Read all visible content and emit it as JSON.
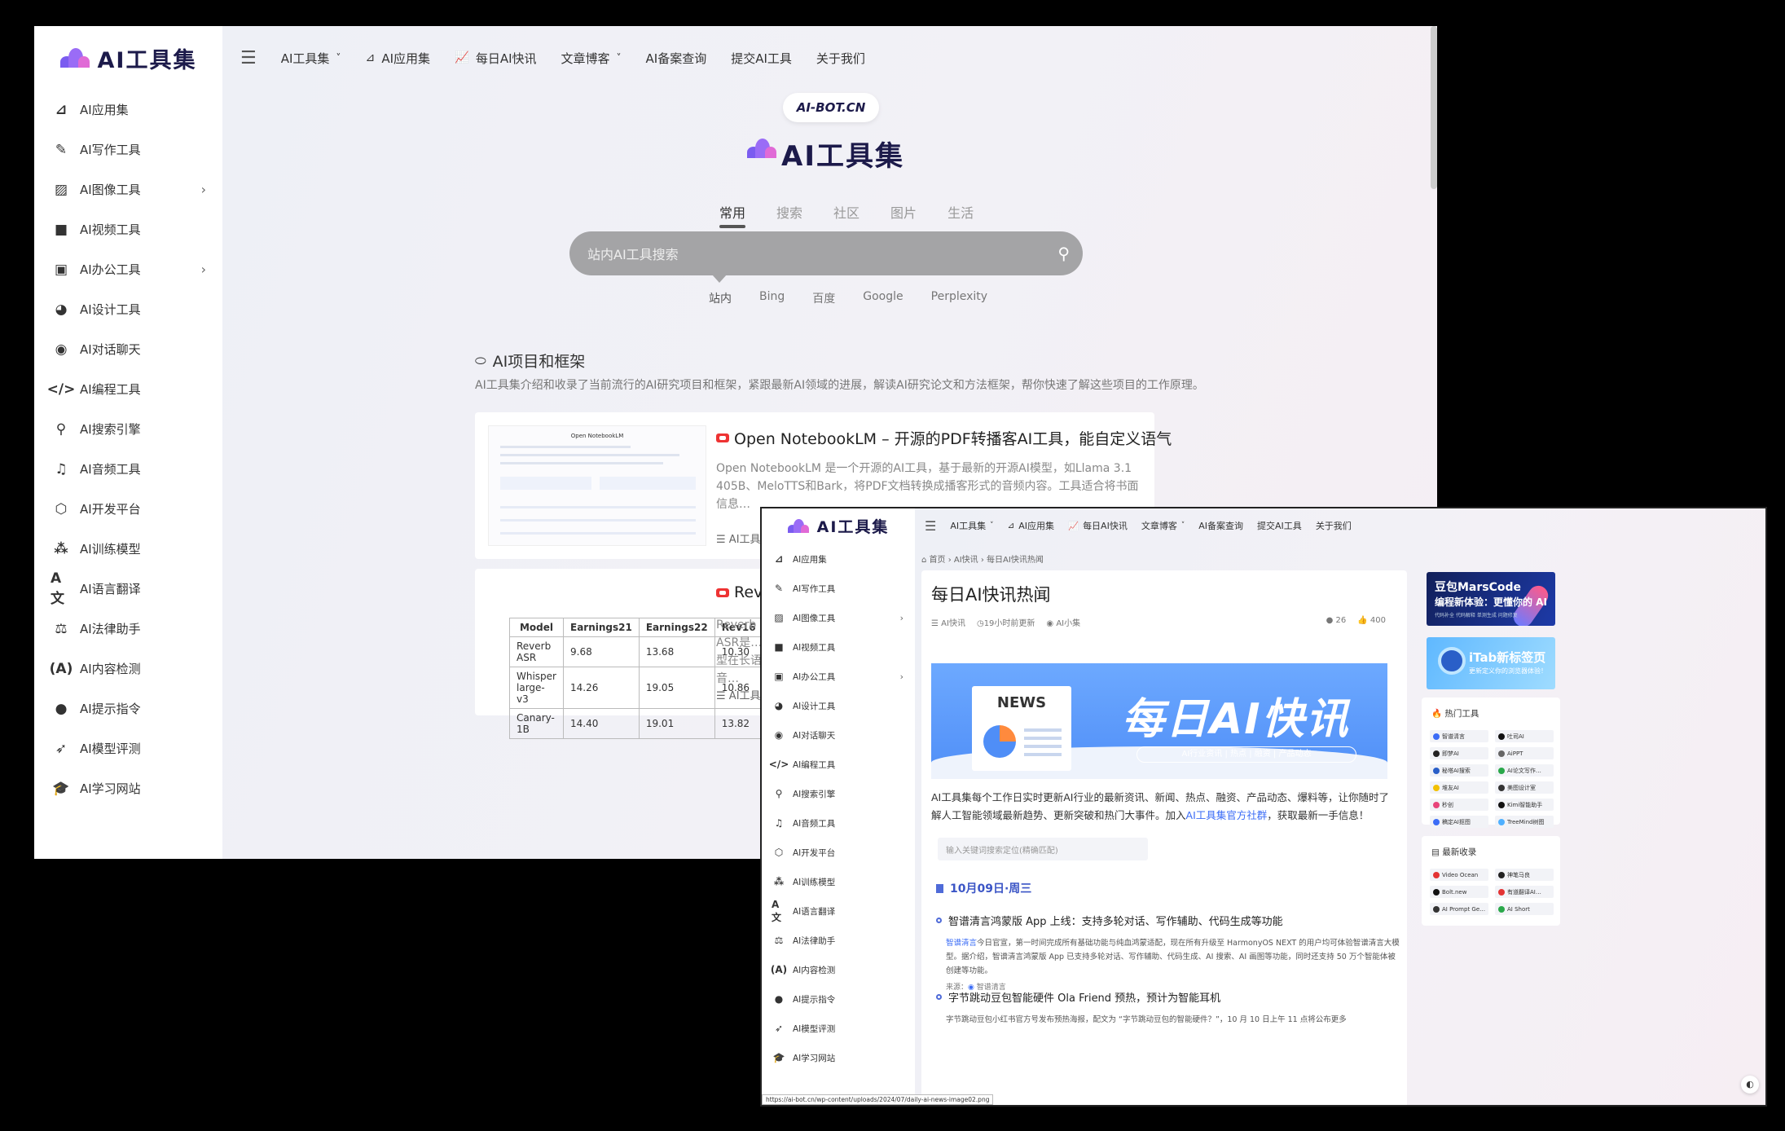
{
  "brand": {
    "name": "AI工具集",
    "site_badge": "AI-BOT.CN"
  },
  "sidebar": {
    "items": [
      {
        "label": "AI应用集",
        "icon": "app-store-icon",
        "glyph": "⊿"
      },
      {
        "label": "AI写作工具",
        "icon": "feather-icon",
        "glyph": "✎"
      },
      {
        "label": "AI图像工具",
        "icon": "image-icon",
        "glyph": "▨",
        "has_sub": true
      },
      {
        "label": "AI视频工具",
        "icon": "video-icon",
        "glyph": "■"
      },
      {
        "label": "AI办公工具",
        "icon": "briefcase-icon",
        "glyph": "▣",
        "has_sub": true
      },
      {
        "label": "AI设计工具",
        "icon": "palette-icon",
        "glyph": "◕"
      },
      {
        "label": "AI对话聊天",
        "icon": "chat-icon",
        "glyph": "◉"
      },
      {
        "label": "AI编程工具",
        "icon": "code-icon",
        "glyph": "</>"
      },
      {
        "label": "AI搜索引擎",
        "icon": "search-icon",
        "glyph": "⚲"
      },
      {
        "label": "AI音频工具",
        "icon": "music-icon",
        "glyph": "♫"
      },
      {
        "label": "AI开发平台",
        "icon": "cube-icon",
        "glyph": "⬡"
      },
      {
        "label": "AI训练模型",
        "icon": "cubes-icon",
        "glyph": "⁂"
      },
      {
        "label": "AI语言翻译",
        "icon": "translate-icon",
        "glyph": "A文"
      },
      {
        "label": "AI法律助手",
        "icon": "scales-icon",
        "glyph": "⚖"
      },
      {
        "label": "AI内容检测",
        "icon": "broadcast-icon",
        "glyph": "(A)"
      },
      {
        "label": "AI提示指令",
        "icon": "bulb-icon",
        "glyph": "●"
      },
      {
        "label": "AI模型评测",
        "icon": "rocket-icon",
        "glyph": "➶"
      },
      {
        "label": "AI学习网站",
        "icon": "graduation-icon",
        "glyph": "🎓"
      }
    ]
  },
  "topnav": [
    {
      "label": "AI工具集",
      "dropdown": true
    },
    {
      "label": "AI应用集",
      "icon": "app-store-icon"
    },
    {
      "label": "每日AI快讯",
      "icon": "chart-icon"
    },
    {
      "label": "文章博客",
      "dropdown": true
    },
    {
      "label": "AI备案查询"
    },
    {
      "label": "提交AI工具"
    },
    {
      "label": "关于我们"
    }
  ],
  "search": {
    "tabs": [
      "常用",
      "搜索",
      "社区",
      "图片",
      "生活"
    ],
    "placeholder": "站内AI工具搜索",
    "engines": [
      "站内",
      "Bing",
      "百度",
      "Google",
      "Perplexity"
    ]
  },
  "section": {
    "title": "AI项目和框架",
    "desc": "AI工具集介绍和收录了当前流行的AI研究项目和框架，紧跟最新AI领域的进展，解读AI研究论文和方法框架，帮你快速了解这些项目的工作原理。"
  },
  "cards": [
    {
      "title": "Open NotebookLM – 开源的PDF转播客AI工具，能自定义语气",
      "desc": "Open NotebookLM 是一个开源的AI工具，基于最新的开源AI模型，如Llama 3.1 405B、MeloTTS和Bark，将PDF文档转换成播客形式的音频内容。工具适合将书面信息…",
      "tag": "AI工具",
      "thumb_title": "Open NotebookLM"
    },
    {
      "title": "Reverb",
      "desc": "Reverb ASR是…模型在长语音…",
      "tag": "AI工具",
      "table": {
        "headers": [
          "Model",
          "Earnings21",
          "Earnings22",
          "Rev16"
        ],
        "rows": [
          [
            "Reverb ASR",
            "9.68",
            "13.68",
            "10.30"
          ],
          [
            "Whisper large-v3",
            "14.26",
            "19.05",
            "10.86"
          ],
          [
            "Canary-1B",
            "14.40",
            "19.01",
            "13.82"
          ]
        ]
      }
    }
  ],
  "article": {
    "breadcrumb": "⌂ 首页 › AI快讯 › 每日AI快讯热闻",
    "title": "每日AI快讯热闻",
    "category": "AI快讯",
    "updated": "19小时前更新",
    "author": "AI小集",
    "comments": "26",
    "likes": "400",
    "banner_title": "每日AI快讯",
    "banner_news": "NEWS",
    "banner_pill": "AI行业资讯 | 热点 | 融资 | 产品动态",
    "intro_a": "AI工具集每个工作日实时更新AI行业的最新资讯、新闻、热点、融资、产品动态、爆料等，让你随时了解人工智能领域最新趋势、更新突破和热门大事件。加入",
    "intro_link": "AI工具集官方社群",
    "intro_b": "，获取最新一手信息！",
    "kw_placeholder": "输入关键词搜索定位(精确匹配)",
    "date": "10月09日·周三",
    "news": [
      {
        "title": "智谱清言鸿蒙版 App 上线：支持多轮对话、写作辅助、代码生成等功能",
        "link": "智谱清言",
        "body": "今日官宣，第一时间完成所有基础功能与纯血鸿蒙适配，现在所有升级至 HarmonyOS NEXT 的用户均可体验智谱清言大模型。据介绍，智谱清言鸿蒙版 App 已支持多轮对话、写作辅助、代码生成、AI 搜索、AI 画图等功能，同时还支持 50 万个智能体被创建等功能。",
        "source_label": "来源：",
        "source": "智谱清言"
      },
      {
        "title": "字节跳动豆包智能硬件 Ola Friend 预热，预计为智能耳机",
        "body": "字节跳动豆包小红书官方号发布预热海报，配文为 “字节跳动豆包的智能硬件？”，10 月 10 日上午 11 点将公布更多"
      }
    ]
  },
  "ads": {
    "ad1_a": "豆包MarsCode",
    "ad1_b": "编程新体验：更懂你的 AI",
    "ad1_c": "代码补全  代码解释  单测生成  问题修复",
    "ad2_a": "iTab新标签页",
    "ad2_b": "更新定义你的浏览器体验！"
  },
  "hot_tools": {
    "title": "热门工具",
    "items": [
      {
        "name": "智谱清言",
        "color": "#3b6cf6"
      },
      {
        "name": "吐司AI",
        "color": "#111111"
      },
      {
        "name": "即梦AI",
        "color": "#222222"
      },
      {
        "name": "AiPPT",
        "color": "#666666"
      },
      {
        "name": "秘塔AI搜索",
        "color": "#2a5fc8"
      },
      {
        "name": "AI论文写作…",
        "color": "#2aa84a"
      },
      {
        "name": "堆友AI",
        "color": "#f2c000"
      },
      {
        "name": "美图设计室",
        "color": "#333333"
      },
      {
        "name": "秒创",
        "color": "#e8447a"
      },
      {
        "name": "Kimi智能助手",
        "color": "#111111"
      },
      {
        "name": "稿定AI抠图",
        "color": "#3b6cf6"
      },
      {
        "name": "TreeMind树图",
        "color": "#4fb0ff"
      }
    ]
  },
  "new_tools": {
    "title": "最新收录",
    "items": [
      {
        "name": "Video Ocean",
        "color": "#e33333"
      },
      {
        "name": "神笔马良",
        "color": "#222222"
      },
      {
        "name": "Bolt.new",
        "color": "#111111"
      },
      {
        "name": "有道翻译AI…",
        "color": "#e33333"
      },
      {
        "name": "AI Prompt Ge…",
        "color": "#333333"
      },
      {
        "name": "AI Short",
        "color": "#2aa84a"
      }
    ]
  },
  "status_url": "https://ai-bot.cn/wp-content/uploads/2024/07/daily-ai-news-image02.png",
  "colors": {
    "accent": "#3b6cf6",
    "brand_dark": "#1c1a4a",
    "logo_purple": "#7b5cf0",
    "logo_pink": "#e06ad6",
    "record_red": "#ee3333"
  }
}
